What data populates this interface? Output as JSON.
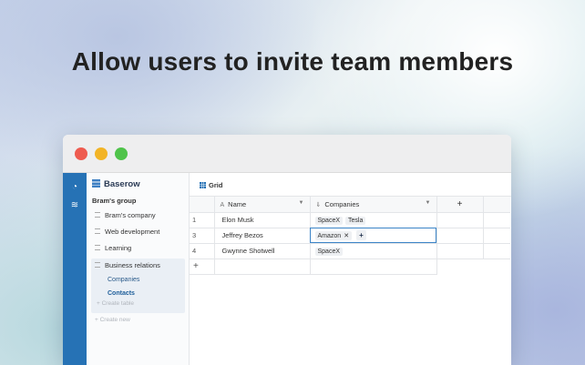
{
  "headline": "Allow users to invite team members",
  "app": {
    "brand": "Baserow",
    "group": "Bram's group",
    "databases": [
      {
        "label": "Bram's company"
      },
      {
        "label": "Web development"
      },
      {
        "label": "Learning"
      },
      {
        "label": "Business relations"
      }
    ],
    "tables": [
      {
        "label": "Companies",
        "active": false
      },
      {
        "label": "Contacts",
        "active": true
      }
    ],
    "create_table": "+ Create table",
    "create_new": "+ Create new",
    "view_label": "Grid"
  },
  "grid": {
    "columns": {
      "name": "Name",
      "companies": "Companies",
      "add": "+"
    },
    "rows": [
      {
        "id": "1",
        "name": "Elon Musk",
        "companies": [
          "SpaceX",
          "Tesla"
        ]
      },
      {
        "id": "3",
        "name": "Jeffrey Bezos",
        "companies": [
          "Amazon"
        ]
      },
      {
        "id": "4",
        "name": "Gwynne Shotwell",
        "companies": [
          "SpaceX"
        ]
      }
    ],
    "add_row": "+"
  },
  "colors": {
    "rail": "#2672b5",
    "accent": "#3b84c7",
    "close": "#ee5b4f",
    "minimize": "#f2b426",
    "maximize": "#4fc34a"
  }
}
